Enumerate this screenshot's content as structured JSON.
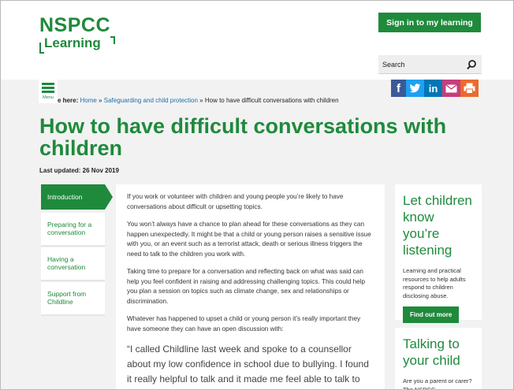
{
  "header": {
    "logo_main": "NSPCC",
    "logo_sub": "Learning",
    "signin_label": "Sign in to my learning",
    "search_placeholder": "Search"
  },
  "menu": {
    "label": "Menu"
  },
  "breadcrumb": {
    "prefix": "e here:",
    "items": [
      "Home",
      "Safeguarding and child protection",
      "How to have difficult conversations with children"
    ],
    "separator": "»"
  },
  "share": {
    "icons": [
      "facebook-icon",
      "twitter-icon",
      "linkedin-icon",
      "email-icon",
      "print-icon"
    ],
    "facebook_glyph": "f",
    "linkedin_glyph": "in"
  },
  "page": {
    "title": "How to have difficult conversations with children",
    "updated": "Last updated: 26 Nov 2019"
  },
  "sidenav": {
    "items": [
      {
        "label": "Introduction",
        "active": true
      },
      {
        "label": "Preparing for a conversation",
        "active": false
      },
      {
        "label": "Having a conversation",
        "active": false
      },
      {
        "label": "Support from Childline",
        "active": false
      }
    ]
  },
  "article": {
    "paragraphs": [
      "If you work or volunteer with children and young people you’re likely to have conversations about difficult or upsetting topics.",
      "You won’t always have a chance to plan ahead for these conversations as they can happen unexpectedly. It might be that a child or young person raises a sensitive issue with you, or an event such as a terrorist attack, death or serious illness triggers the need to talk to the children you work with.",
      "Taking time to prepare for a conversation and reflecting back on what was said can help you feel confident in raising and addressing challenging topics. This could help you plan a session on topics such as climate change, sex and relationships or discrimination.",
      "Whatever has happened to upset a child or young person it’s really important they have someone they can have an open discussion with:"
    ],
    "quote": "“I called Childline last week and spoke to a counsellor about my low confidence in school due to bullying. I found it really helpful to talk and it made me feel able to talk to my teacher who really"
  },
  "sidebar": {
    "card1": {
      "title": "Let children know you’re listening",
      "text": "Learning and practical resources to help adults respond to children disclosing abuse.",
      "button": "Find out more"
    },
    "card2": {
      "title": "Talking to your child",
      "text": "Are you a parent or carer? The NSPCC"
    }
  },
  "colors": {
    "brand_green": "#1f8a3c",
    "link_blue": "#1f6fa8",
    "facebook": "#3b5998",
    "twitter": "#1da1f2",
    "linkedin": "#0077b5",
    "email": "#c63d7c",
    "print": "#ea6a2f"
  }
}
